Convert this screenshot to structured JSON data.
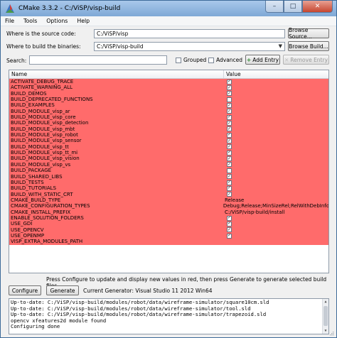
{
  "window": {
    "title": "CMake 3.3.2 - C:/ViSP/visp-build",
    "controls": {
      "minimize": "–",
      "maximize": "□",
      "close": "✕"
    }
  },
  "menu": [
    "File",
    "Tools",
    "Options",
    "Help"
  ],
  "source": {
    "label": "Where is the source code:",
    "value": "C:/ViSP/visp",
    "browse_label": "Browse Source..."
  },
  "build": {
    "label": "Where to build the binaries:",
    "value": "C:/ViSP/visp-build",
    "browse_label": "Browse Build..."
  },
  "search": {
    "label": "Search:",
    "value": "",
    "grouped_label": "Grouped",
    "advanced_label": "Advanced",
    "add_entry_label": "Add Entry",
    "remove_entry_label": "Remove Entry"
  },
  "table": {
    "headers": {
      "name": "Name",
      "value": "Value"
    },
    "highlight_color": "#ff6b6b",
    "rows": [
      {
        "name": "ACTIVATE_DEBUG_TRACE",
        "type": "bool",
        "checked": true
      },
      {
        "name": "ACTIVATE_WARNING_ALL",
        "type": "bool",
        "checked": true
      },
      {
        "name": "BUILD_DEMOS",
        "type": "bool",
        "checked": true
      },
      {
        "name": "BUILD_DEPRECATED_FUNCTIONS",
        "type": "bool",
        "checked": false
      },
      {
        "name": "BUILD_EXAMPLES",
        "type": "bool",
        "checked": true
      },
      {
        "name": "BUILD_MODULE_visp_ar",
        "type": "bool",
        "checked": true
      },
      {
        "name": "BUILD_MODULE_visp_core",
        "type": "bool",
        "checked": true
      },
      {
        "name": "BUILD_MODULE_visp_detection",
        "type": "bool",
        "checked": true
      },
      {
        "name": "BUILD_MODULE_visp_mbt",
        "type": "bool",
        "checked": true
      },
      {
        "name": "BUILD_MODULE_visp_robot",
        "type": "bool",
        "checked": true
      },
      {
        "name": "BUILD_MODULE_visp_sensor",
        "type": "bool",
        "checked": true
      },
      {
        "name": "BUILD_MODULE_visp_tt",
        "type": "bool",
        "checked": true
      },
      {
        "name": "BUILD_MODULE_visp_tt_mi",
        "type": "bool",
        "checked": true
      },
      {
        "name": "BUILD_MODULE_visp_vision",
        "type": "bool",
        "checked": true
      },
      {
        "name": "BUILD_MODULE_visp_vs",
        "type": "bool",
        "checked": true
      },
      {
        "name": "BUILD_PACKAGE",
        "type": "bool",
        "checked": false
      },
      {
        "name": "BUILD_SHARED_LIBS",
        "type": "bool",
        "checked": true
      },
      {
        "name": "BUILD_TESTS",
        "type": "bool",
        "checked": true
      },
      {
        "name": "BUILD_TUTORIALS",
        "type": "bool",
        "checked": true
      },
      {
        "name": "BUILD_WITH_STATIC_CRT",
        "type": "bool",
        "checked": true
      },
      {
        "name": "CMAKE_BUILD_TYPE",
        "type": "text",
        "value": "Release"
      },
      {
        "name": "CMAKE_CONFIGURATION_TYPES",
        "type": "text",
        "value": "Debug;Release;MinSizeRel;RelWithDebInfo"
      },
      {
        "name": "CMAKE_INSTALL_PREFIX",
        "type": "text",
        "value": "C:/ViSP/visp-build/install"
      },
      {
        "name": "ENABLE_SOLUTION_FOLDERS",
        "type": "bool",
        "checked": true
      },
      {
        "name": "USE_GDI",
        "type": "bool",
        "checked": true
      },
      {
        "name": "USE_OPENCV",
        "type": "bool",
        "checked": true
      },
      {
        "name": "USE_OPENMP",
        "type": "bool",
        "checked": true
      },
      {
        "name": "VISP_EXTRA_MODULES_PATH",
        "type": "text",
        "value": ""
      }
    ]
  },
  "hint": "Press Configure to update and display new values in red, then press Generate to generate selected build files.",
  "actions": {
    "configure_label": "Configure",
    "generate_label": "Generate",
    "generator_text": "Current Generator: Visual Studio 11 2012 Win64"
  },
  "output": [
    "Up-to-date: C:/ViSP/visp-build/modules/robot/data/wireframe-simulator/square10cm.sld",
    "Up-to-date: C:/ViSP/visp-build/modules/robot/data/wireframe-simulator/tool.sld",
    "Up-to-date: C:/ViSP/visp-build/modules/robot/data/wireframe-simulator/trapezoid.sld",
    "opencv xfeatures2d module found",
    "Configuring done"
  ]
}
